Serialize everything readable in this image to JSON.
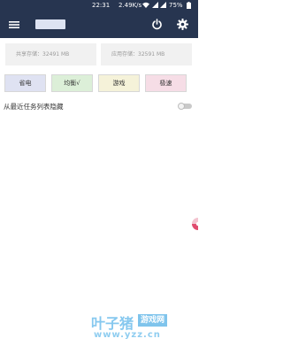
{
  "status_bar": {
    "time": "22:31",
    "network_speed": "2.49K/s",
    "battery_percent": "75%"
  },
  "toolbar": {
    "menu_icon": "menu-icon",
    "power_icon": "power-icon",
    "settings_icon": "gear-icon"
  },
  "storage": {
    "shared_label": "共享存储：32491 MB",
    "app_label": "应用存储：32591 MB"
  },
  "modes": {
    "save": "省电",
    "balance": "均衡√",
    "game": "游戏",
    "fast": "极速"
  },
  "hide_from_recents": {
    "label": "从最近任务列表隐藏",
    "enabled": false
  },
  "watermark": {
    "brand": "叶子猪",
    "badge": "游戏网",
    "url": "www.yzz.cn"
  },
  "colors": {
    "header_bg": "#273550",
    "save_bg": "#dfe2f2",
    "balance_bg": "#dcefd8",
    "game_bg": "#f5f2d9",
    "fast_bg": "#f6dde6"
  }
}
